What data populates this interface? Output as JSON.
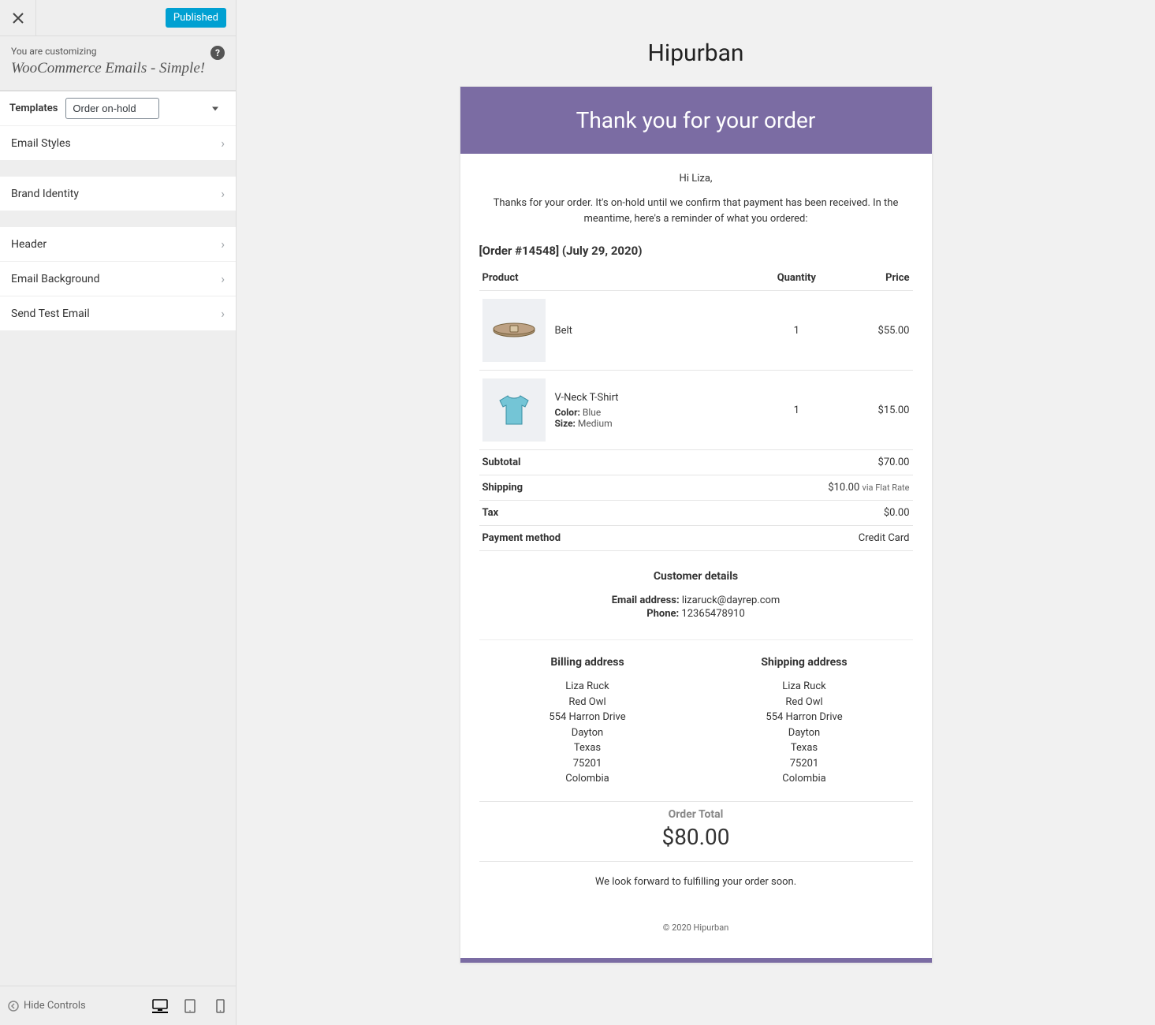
{
  "sidebar": {
    "published": "Published",
    "customizing_label": "You are customizing",
    "customizing_title": "WooCommerce Emails - Simple!",
    "templates_label": "Templates",
    "templates_selected": "Order on-hold",
    "nav": {
      "email_styles": "Email Styles",
      "brand_identity": "Brand Identity",
      "header": "Header",
      "email_background": "Email Background",
      "send_test": "Send Test Email"
    },
    "hide_controls": "Hide Controls"
  },
  "email": {
    "brand": "Hipurban",
    "header_title": "Thank you for your order",
    "greeting": "Hi Liza,",
    "intro": "Thanks for your order. It's on-hold until we confirm that payment has been received. In the meantime, here's a reminder of what you ordered:",
    "order_heading": "[Order #14548] (July 29, 2020)",
    "columns": {
      "product": "Product",
      "quantity": "Quantity",
      "price": "Price"
    },
    "items": [
      {
        "name": "Belt",
        "qty": "1",
        "price": "$55.00"
      },
      {
        "name": "V-Neck T-Shirt",
        "qty": "1",
        "price": "$15.00",
        "meta": [
          {
            "label": "Color:",
            "value": "Blue"
          },
          {
            "label": "Size:",
            "value": "Medium"
          }
        ]
      }
    ],
    "totals": {
      "subtotal_label": "Subtotal",
      "subtotal_value": "$70.00",
      "shipping_label": "Shipping",
      "shipping_value": "$10.00",
      "shipping_note": "via Flat Rate",
      "tax_label": "Tax",
      "tax_value": "$0.00",
      "payment_label": "Payment method",
      "payment_value": "Credit Card"
    },
    "customer_details_heading": "Customer details",
    "customer_email_label": "Email address:",
    "customer_email": "lizaruck@dayrep.com",
    "customer_phone_label": "Phone:",
    "customer_phone": "12365478910",
    "billing_heading": "Billing address",
    "shipping_heading": "Shipping address",
    "billing_lines": [
      "Liza Ruck",
      "Red Owl",
      "554 Harron Drive",
      "Dayton",
      "Texas",
      "75201",
      "Colombia"
    ],
    "shipping_lines": [
      "Liza Ruck",
      "Red Owl",
      "554 Harron Drive",
      "Dayton",
      "Texas",
      "75201",
      "Colombia"
    ],
    "order_total_label": "Order Total",
    "order_total_value": "$80.00",
    "closing": "We look forward to fulfilling your order soon.",
    "footer": "© 2020 Hipurban"
  }
}
